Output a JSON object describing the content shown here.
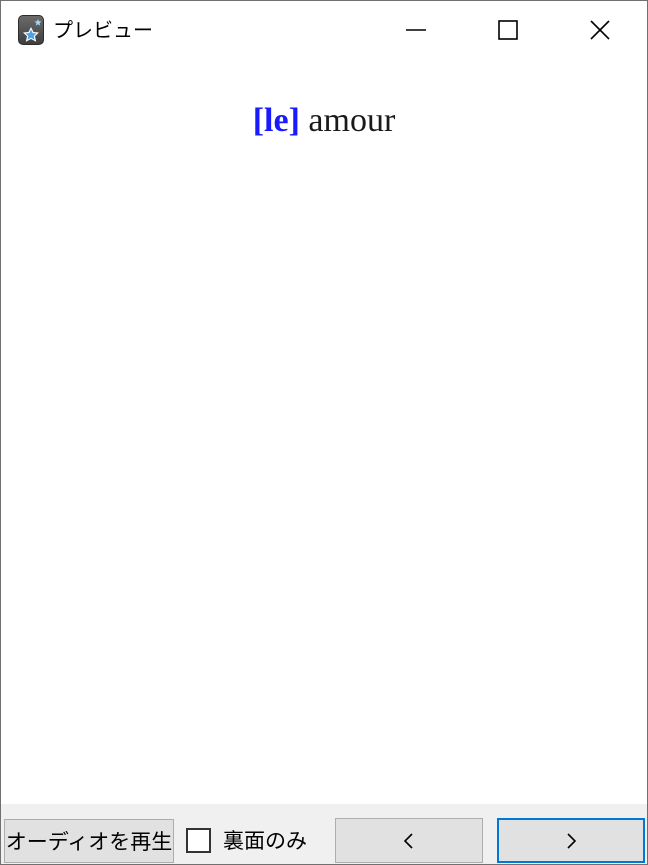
{
  "window": {
    "title": "プレビュー"
  },
  "card": {
    "article": "[le]",
    "word": "amour"
  },
  "toolbar": {
    "play_audio_label": "オーディオを再生",
    "back_only_label": "裏面のみ",
    "back_only_checked": false,
    "prev_label": "<",
    "next_label": ">"
  },
  "colors": {
    "article": "#1a1aff",
    "focus_border": "#0078d7",
    "bar_background": "#f0f0f0"
  },
  "icons": {
    "app": "anki-star-icon",
    "minimize": "minimize-icon",
    "maximize": "maximize-icon",
    "close": "close-icon"
  }
}
